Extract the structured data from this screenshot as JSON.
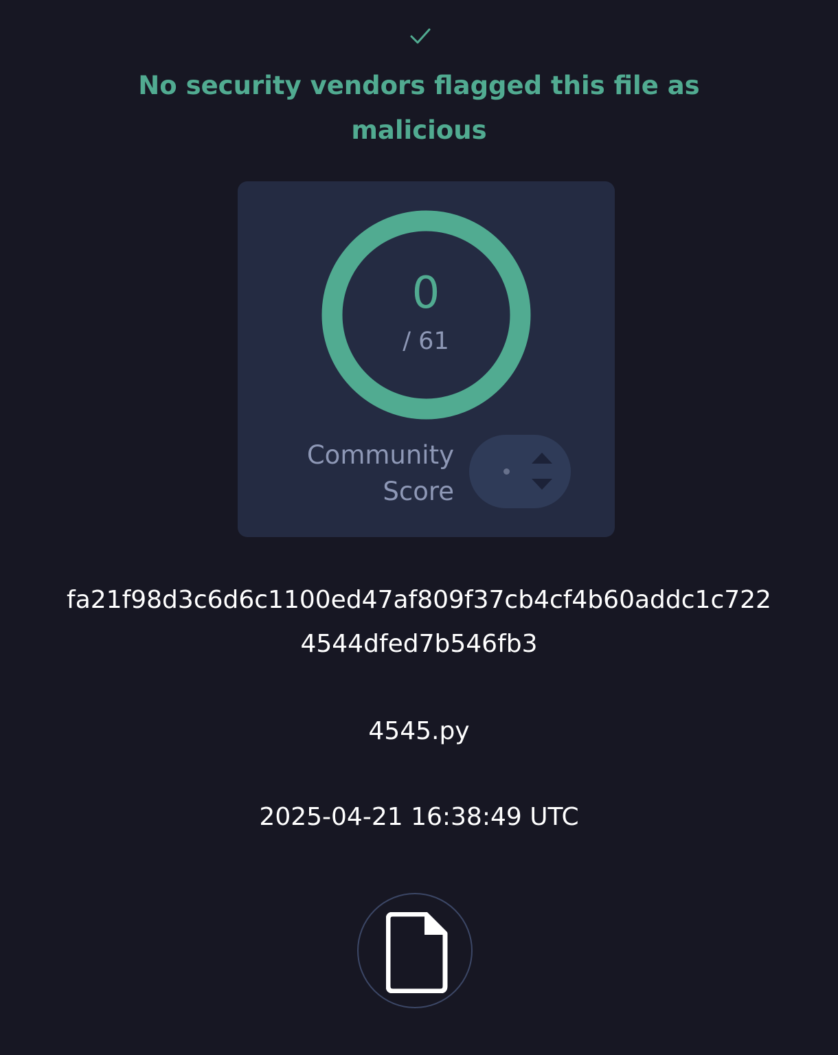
{
  "status": {
    "icon": "checkmark-icon",
    "headline": "No security vendors flagged this file as malicious",
    "color": "#51ab91"
  },
  "detection": {
    "score": "0",
    "total": "/ 61",
    "detected_fraction": 0,
    "ring_color": "#51ab91"
  },
  "community": {
    "label": "Community Score",
    "value": "•",
    "upvote_icon": "chevron-up-icon",
    "downvote_icon": "chevron-down-icon"
  },
  "file": {
    "hash": "fa21f98d3c6d6c1100ed47af809f37cb4cf4b60addc1c7224544dfed7b546fb3",
    "name": "4545.py",
    "date": "2025-04-21 16:38:49 UTC",
    "type_icon": "file-icon"
  }
}
